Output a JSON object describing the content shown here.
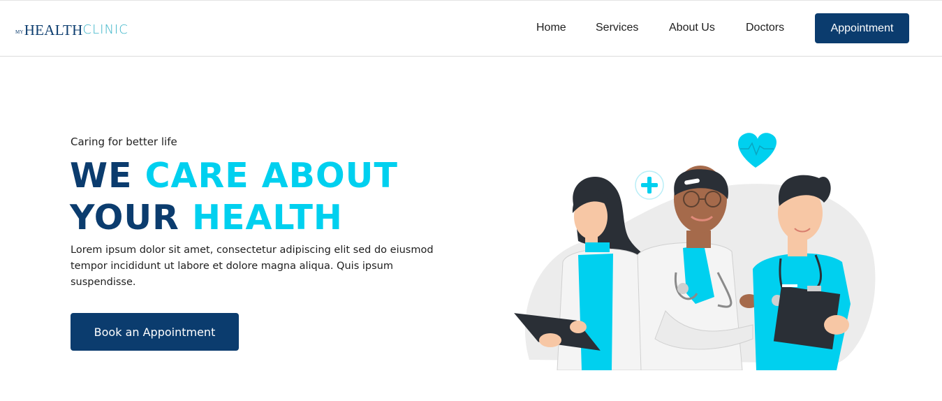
{
  "brand": {
    "logo_my": "MY",
    "logo_health": "HEALTH",
    "logo_clinic": "CLINIC"
  },
  "nav": {
    "items": [
      {
        "label": "Home"
      },
      {
        "label": "Services"
      },
      {
        "label": "About Us"
      },
      {
        "label": "Doctors"
      }
    ],
    "cta_label": "Appointment"
  },
  "hero": {
    "tagline": "Caring for better life",
    "headline": {
      "line1_dark": "WE",
      "line1_cyan": "CARE ABOUT",
      "line2_dark": "YOUR",
      "line2_cyan": "HEALTH"
    },
    "description": "Lorem ipsum dolor sit amet, consectetur adipiscing elit sed do eiusmod tempor incididunt ut labore et dolore magna aliqua. Quis ipsum suspendisse.",
    "cta_label": "Book an Appointment"
  },
  "illustration": {
    "icons": [
      "heart-icon",
      "plus-icon"
    ],
    "figures": [
      "female-doctor",
      "male-doctor",
      "male-nurse"
    ]
  },
  "colors": {
    "primary_navy": "#0b3c6e",
    "accent_cyan": "#00d0ef",
    "logo_teal": "#3ab4c8",
    "text_dark": "#1e1e1e",
    "background": "#ffffff"
  }
}
